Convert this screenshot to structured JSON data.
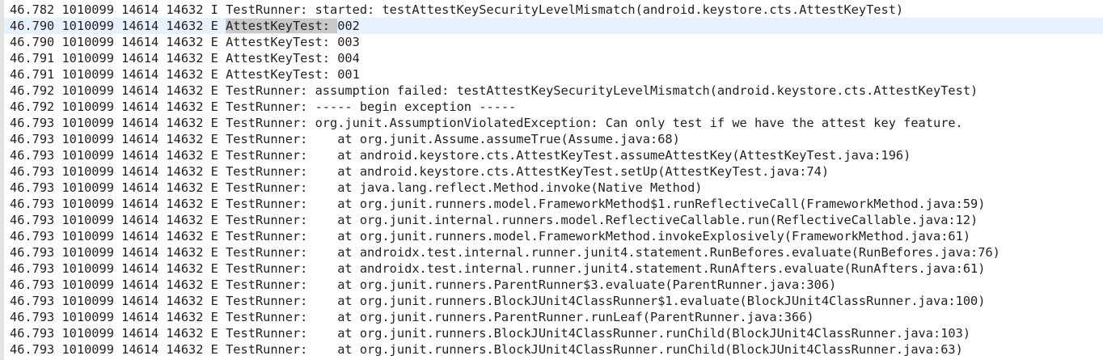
{
  "log": {
    "current_line_index": 1,
    "selection": {
      "line": 1,
      "text": "AttestKeyTest: "
    },
    "lines": [
      "46.782 1010099 14614 14632 I TestRunner: started: testAttestKeySecurityLevelMismatch(android.keystore.cts.AttestKeyTest)",
      "46.790 1010099 14614 14632 E AttestKeyTest: 002",
      "46.790 1010099 14614 14632 E AttestKeyTest: 003",
      "46.791 1010099 14614 14632 E AttestKeyTest: 004",
      "46.791 1010099 14614 14632 E AttestKeyTest: 001",
      "46.792 1010099 14614 14632 E TestRunner: assumption failed: testAttestKeySecurityLevelMismatch(android.keystore.cts.AttestKeyTest)",
      "46.792 1010099 14614 14632 E TestRunner: ----- begin exception -----",
      "46.793 1010099 14614 14632 E TestRunner: org.junit.AssumptionViolatedException: Can only test if we have the attest key feature.",
      "46.793 1010099 14614 14632 E TestRunner:    at org.junit.Assume.assumeTrue(Assume.java:68)",
      "46.793 1010099 14614 14632 E TestRunner:    at android.keystore.cts.AttestKeyTest.assumeAttestKey(AttestKeyTest.java:196)",
      "46.793 1010099 14614 14632 E TestRunner:    at android.keystore.cts.AttestKeyTest.setUp(AttestKeyTest.java:74)",
      "46.793 1010099 14614 14632 E TestRunner:    at java.lang.reflect.Method.invoke(Native Method)",
      "46.793 1010099 14614 14632 E TestRunner:    at org.junit.runners.model.FrameworkMethod$1.runReflectiveCall(FrameworkMethod.java:59)",
      "46.793 1010099 14614 14632 E TestRunner:    at org.junit.internal.runners.model.ReflectiveCallable.run(ReflectiveCallable.java:12)",
      "46.793 1010099 14614 14632 E TestRunner:    at org.junit.runners.model.FrameworkMethod.invokeExplosively(FrameworkMethod.java:61)",
      "46.793 1010099 14614 14632 E TestRunner:    at androidx.test.internal.runner.junit4.statement.RunBefores.evaluate(RunBefores.java:76)",
      "46.793 1010099 14614 14632 E TestRunner:    at androidx.test.internal.runner.junit4.statement.RunAfters.evaluate(RunAfters.java:61)",
      "46.793 1010099 14614 14632 E TestRunner:    at org.junit.runners.ParentRunner$3.evaluate(ParentRunner.java:306)",
      "46.793 1010099 14614 14632 E TestRunner:    at org.junit.runners.BlockJUnit4ClassRunner$1.evaluate(BlockJUnit4ClassRunner.java:100)",
      "46.793 1010099 14614 14632 E TestRunner:    at org.junit.runners.ParentRunner.runLeaf(ParentRunner.java:366)",
      "46.793 1010099 14614 14632 E TestRunner:    at org.junit.runners.BlockJUnit4ClassRunner.runChild(BlockJUnit4ClassRunner.java:103)",
      "46.793 1010099 14614 14632 E TestRunner:    at org.junit.runners.BlockJUnit4ClassRunner.runChild(BlockJUnit4ClassRunner.java:63)"
    ]
  },
  "colors": {
    "background": "#ffffff",
    "text": "#222222",
    "current_line": "#e8f2fe",
    "selection": "#c9c9c9",
    "gutter": "#e4e4e4"
  }
}
